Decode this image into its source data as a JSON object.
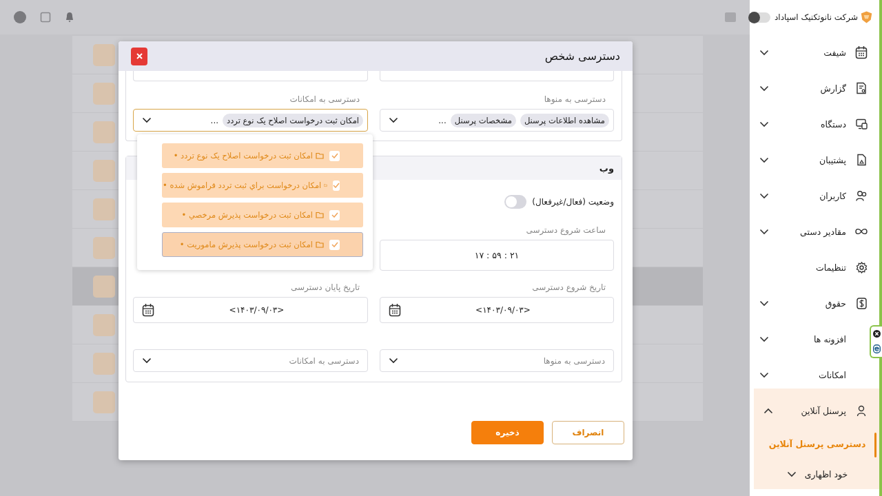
{
  "background": {
    "rows": [
      {
        "selected": false
      },
      {
        "selected": false
      },
      {
        "selected": false
      },
      {
        "selected": false
      },
      {
        "selected": false
      },
      {
        "selected": false
      },
      {
        "selected": true
      },
      {
        "selected": false
      },
      {
        "selected": false
      },
      {
        "selected": false
      }
    ]
  },
  "dialog": {
    "title": "دسترسی شخص",
    "access_card": {
      "fields": [
        {
          "label": "دسترسی به منوها",
          "chips": [
            "مشاهده اطلاعات پرسنل",
            "مشخصات پرسنل"
          ],
          "more": "...",
          "focused": false
        },
        {
          "label": "دسترسی به امکانات",
          "chips": [
            "امکان ثبت درخواست اصلاح یک نوع تردد"
          ],
          "more": "...",
          "focused": true
        }
      ]
    },
    "options_popup": {
      "items": [
        {
          "label": "امکان ثبت درخواست اصلاح یک نوع تردد •",
          "checked": true,
          "highlighted": false
        },
        {
          "label": "امکان درخواست براي ثبت تردد فراموش شده •",
          "checked": true,
          "highlighted": false
        },
        {
          "label": "امکان ثبت درخواست پذيرش مرخصي •",
          "checked": true,
          "highlighted": false
        },
        {
          "label": "امکان ثبت درخواست پذيرش ماموريت •",
          "checked": true,
          "highlighted": true
        }
      ]
    },
    "web_card": {
      "title": "وب",
      "status": {
        "label": "وضعیت (فعال/غیرفعال)",
        "on": false
      },
      "start_time": {
        "label": "ساعت شروع دسترسی",
        "value": "۱۷ : ۵۹ : ۲۱"
      },
      "start_date": {
        "label": "تاریخ شروع دسترسی",
        "value": "<۱۴۰۳/۰۹/۰۳>"
      },
      "end_date": {
        "label": "تاریخ پایان دسترسی",
        "value": "<۱۴۰۳/۰۹/۰۳>"
      },
      "menu_access": {
        "placeholder": "دسترسی به منوها"
      },
      "feature_access": {
        "placeholder": "دسترسی به امکانات"
      }
    },
    "buttons": [
      {
        "label": "انصراف",
        "kind": "secondary"
      },
      {
        "label": "ذخیره",
        "kind": "primary"
      }
    ]
  },
  "sidebar": {
    "company": "شرکت نانوتکنیک اسپاداد",
    "theme_toggle": {
      "on": false
    },
    "items": [
      {
        "label": "شیفت",
        "has_submenu": true,
        "expanded": false
      },
      {
        "label": "گزارش",
        "has_submenu": true,
        "expanded": false
      },
      {
        "label": "دستگاه",
        "has_submenu": true,
        "expanded": false
      },
      {
        "label": "پشتیبان",
        "has_submenu": true,
        "expanded": false
      },
      {
        "label": "کاربران",
        "has_submenu": true,
        "expanded": false
      },
      {
        "label": "مقادیر دستی",
        "has_submenu": true,
        "expanded": false
      },
      {
        "label": "تنظیمات",
        "has_submenu": false,
        "expanded": false
      },
      {
        "label": "حقوق",
        "has_submenu": true,
        "expanded": false
      },
      {
        "label": "افزونه ها",
        "has_submenu": true,
        "expanded": false
      },
      {
        "label": "امکانات",
        "has_submenu": true,
        "expanded": false
      },
      {
        "label": "پرسنل آنلاین",
        "has_submenu": true,
        "expanded": true,
        "children": [
          {
            "label": "دسترسی پرسنل آنلاین",
            "selected": true,
            "has_submenu": false
          },
          {
            "label": "خود اظهاری",
            "selected": false,
            "has_submenu": true
          }
        ]
      }
    ]
  }
}
